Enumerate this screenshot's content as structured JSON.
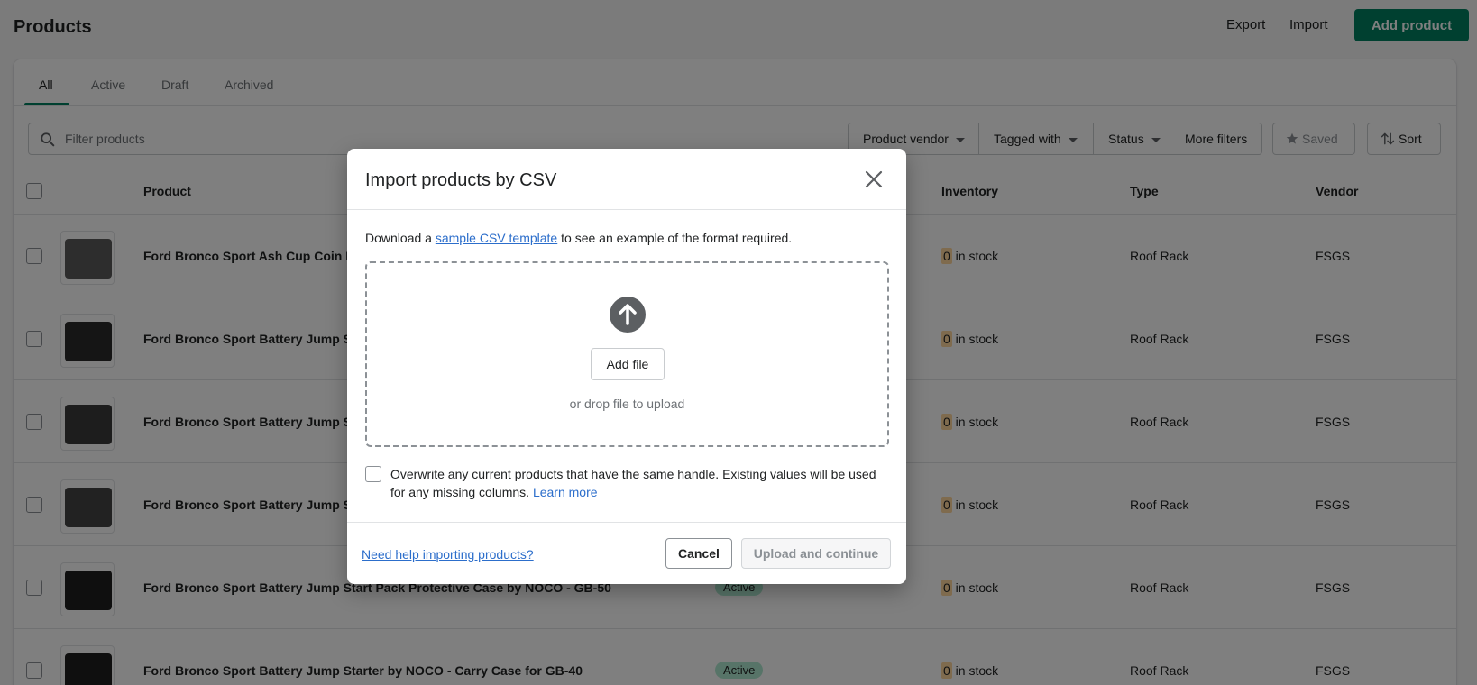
{
  "header": {
    "title": "Products",
    "export_label": "Export",
    "import_label": "Import",
    "add_product_label": "Add product"
  },
  "tabs": [
    {
      "label": "All",
      "active": true
    },
    {
      "label": "Active",
      "active": false
    },
    {
      "label": "Draft",
      "active": false
    },
    {
      "label": "Archived",
      "active": false
    }
  ],
  "filters": {
    "search_placeholder": "Filter products",
    "buttons": [
      "Product vendor",
      "Tagged with",
      "Status",
      "More filters"
    ],
    "saved_label": "Saved",
    "sort_label": "Sort"
  },
  "table": {
    "columns": [
      "Product",
      "Inventory",
      "Type",
      "Vendor"
    ],
    "rows": [
      {
        "name": "Ford Bronco Sport Ash Cup Coin Ho",
        "status": "",
        "inventory_count": "0",
        "inventory_suffix": " in stock",
        "type": "Roof Rack",
        "vendor": "FSGS",
        "thumb_color": "#5a5a5a"
      },
      {
        "name": "Ford Bronco Sport Battery Jump Sta",
        "status": "",
        "inventory_count": "0",
        "inventory_suffix": " in stock",
        "type": "Roof Rack",
        "vendor": "FSGS",
        "thumb_color": "#2b2b2b"
      },
      {
        "name": "Ford Bronco Sport Battery Jump Sta",
        "status": "",
        "inventory_count": "0",
        "inventory_suffix": " in stock",
        "type": "Roof Rack",
        "vendor": "FSGS",
        "thumb_color": "#3a3a3a"
      },
      {
        "name": "Ford Bronco Sport Battery Jump Sta",
        "status": "",
        "inventory_count": "0",
        "inventory_suffix": " in stock",
        "type": "Roof Rack",
        "vendor": "FSGS",
        "thumb_color": "#444444"
      },
      {
        "name": "Ford Bronco Sport Battery Jump Start Pack Protective Case by NOCO - GB-50",
        "status": "Active",
        "inventory_count": "0",
        "inventory_suffix": " in stock",
        "type": "Roof Rack",
        "vendor": "FSGS",
        "thumb_color": "#1e1e1e"
      },
      {
        "name": "Ford Bronco Sport Battery Jump Starter by NOCO - Carry Case for GB-40",
        "status": "Active",
        "inventory_count": "0",
        "inventory_suffix": " in stock",
        "type": "Roof Rack",
        "vendor": "FSGS",
        "thumb_color": "#1e1e1e"
      }
    ]
  },
  "modal": {
    "title": "Import products by CSV",
    "download_prefix": "Download a ",
    "download_link": "sample CSV template",
    "download_suffix": " to see an example of the format required.",
    "add_file_label": "Add file",
    "drop_text": "or drop file to upload",
    "overwrite_text": "Overwrite any current products that have the same handle. Existing values will be used for any missing columns. ",
    "learn_more": "Learn more",
    "help_link": "Need help importing products?",
    "cancel_label": "Cancel",
    "upload_label": "Upload and continue"
  },
  "colors": {
    "primary": "#008060",
    "link": "#2c6ecb",
    "badge_active": "#aee9d1",
    "inventory_zero": "#ffd79d"
  }
}
